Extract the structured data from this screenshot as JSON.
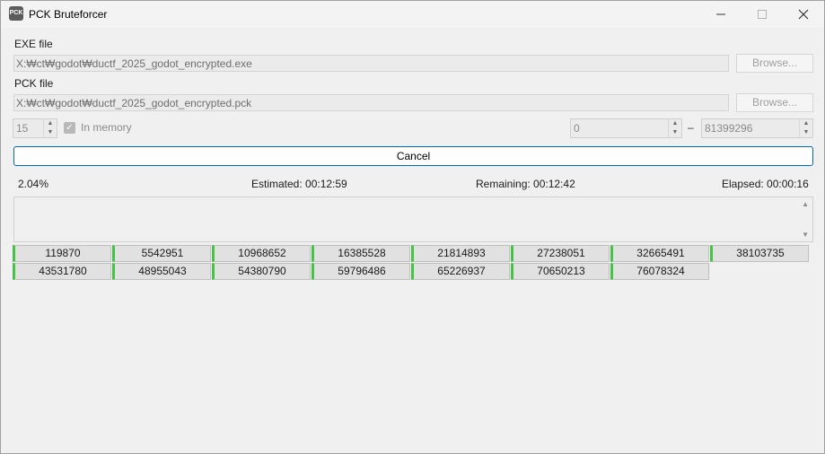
{
  "window": {
    "title": "PCK Bruteforcer",
    "icon": "pck-app-icon"
  },
  "exe": {
    "label": "EXE file",
    "path": "X:₩ct₩godot₩ductf_2025_godot_encrypted.exe",
    "browse_label": "Browse..."
  },
  "pck": {
    "label": "PCK file",
    "path": "X:₩ct₩godot₩ductf_2025_godot_encrypted.pck",
    "browse_label": "Browse..."
  },
  "options": {
    "threads": "15",
    "in_memory_label": "In memory",
    "in_memory_checked": true,
    "range_start": "0",
    "range_separator": "–",
    "range_end": "81399296"
  },
  "cancel_label": "Cancel",
  "progress": {
    "percent": "2.04%",
    "estimated": "Estimated: 00:12:59",
    "remaining": "Remaining: 00:12:42",
    "elapsed": "Elapsed: 00:00:16"
  },
  "results": [
    "119870",
    "5542951",
    "10968652",
    "16385528",
    "21814893",
    "27238051",
    "32665491",
    "38103735",
    "43531780",
    "48955043",
    "54380790",
    "59796486",
    "65226937",
    "70650213",
    "76078324"
  ],
  "colors": {
    "accent": "#0067c0",
    "cell_marker": "#45c345"
  }
}
